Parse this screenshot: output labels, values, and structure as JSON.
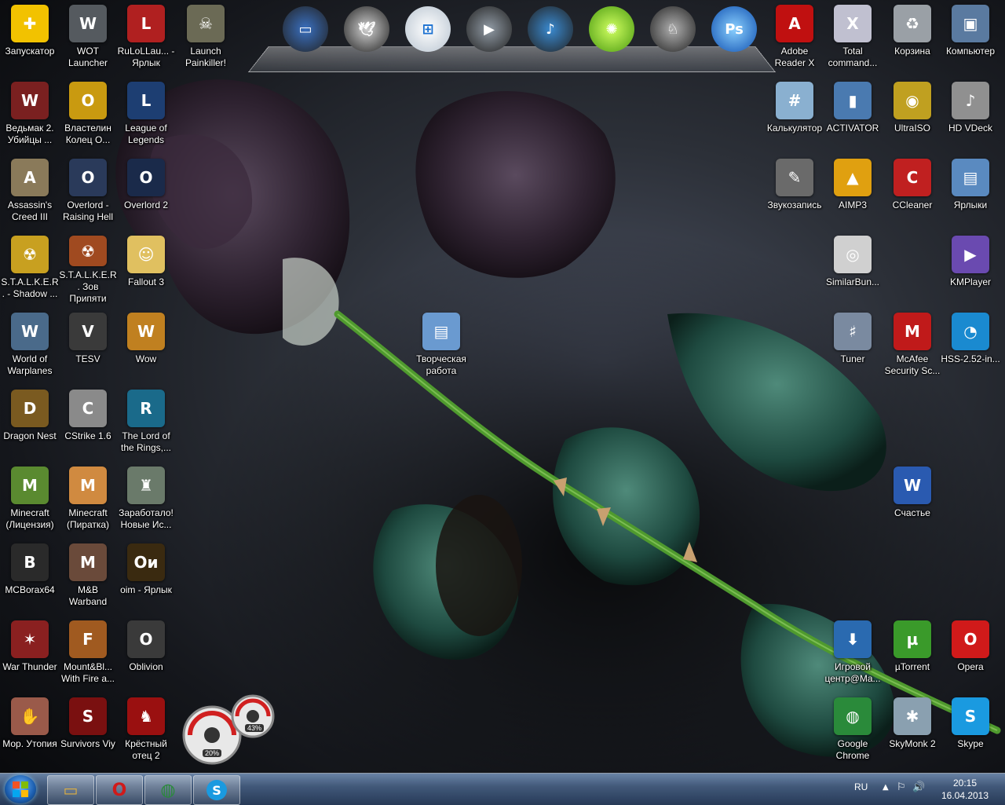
{
  "desktop": {
    "icons": [
      {
        "label": "Запускатор",
        "color": "#f2c200",
        "glyph": "✚"
      },
      {
        "label": "WOT Launcher",
        "color": "#555a5f",
        "glyph": "W"
      },
      {
        "label": "RuLoLLau... - Ярлык",
        "color": "#b02020",
        "glyph": "L"
      },
      {
        "label": "Launch Painkiller!",
        "color": "#6b6a55",
        "glyph": "☠"
      },
      {
        "label": "Ведьмак 2. Убийцы ...",
        "color": "#7a2020",
        "glyph": "W"
      },
      {
        "label": "Властелин Колец О...",
        "color": "#c99a10",
        "glyph": "O"
      },
      {
        "label": "League of Legends",
        "color": "#1d3e72",
        "glyph": "L"
      },
      {
        "label": "Assassin's Creed III",
        "color": "#8a7a5a",
        "glyph": "A"
      },
      {
        "label": "Overlord - Raising Hell",
        "color": "#2a3a5a",
        "glyph": "O"
      },
      {
        "label": "Overlord 2",
        "color": "#1a2a4a",
        "glyph": "O"
      },
      {
        "label": "S.T.A.L.K.E.R. - Shadow ...",
        "color": "#c8a020",
        "glyph": "☢"
      },
      {
        "label": "S.T.A.L.K.E.R. Зов Припяти",
        "color": "#a04a20",
        "glyph": "☢"
      },
      {
        "label": "Fallout 3",
        "color": "#e0c060",
        "glyph": "☺"
      },
      {
        "label": "World of Warplanes",
        "color": "#4a6a8a",
        "glyph": "W"
      },
      {
        "label": "TESV",
        "color": "#3a3a3a",
        "glyph": "V"
      },
      {
        "label": "Wow",
        "color": "#c08020",
        "glyph": "W"
      },
      {
        "label": "Dragon Nest",
        "color": "#7a5a20",
        "glyph": "D"
      },
      {
        "label": "CStrike 1.6",
        "color": "#8a8a8a",
        "glyph": "C"
      },
      {
        "label": "The Lord of the Rings,...",
        "color": "#1a6a8a",
        "glyph": "R"
      },
      {
        "label": "Minecraft (Лицензия)",
        "color": "#5a8a30",
        "glyph": "M"
      },
      {
        "label": "Minecraft (Пиратка)",
        "color": "#d08a40",
        "glyph": "M"
      },
      {
        "label": "Заработало! Новые Ис...",
        "color": "#6a7a6a",
        "glyph": "♜"
      },
      {
        "label": "MCBorax64",
        "color": "#2a2a2a",
        "glyph": "B"
      },
      {
        "label": "M&B Warband",
        "color": "#6a4a3a",
        "glyph": "M"
      },
      {
        "label": "oim - Ярлык",
        "color": "#3a2a10",
        "glyph": "Oи"
      },
      {
        "label": "War Thunder",
        "color": "#8a2020",
        "glyph": "✶"
      },
      {
        "label": "Mount&Bl... With Fire a...",
        "color": "#a05a20",
        "glyph": "F"
      },
      {
        "label": "Oblivion",
        "color": "#3a3a3a",
        "glyph": "O"
      },
      {
        "label": "Мор. Утопия",
        "color": "#9a5a4a",
        "glyph": "✋"
      },
      {
        "label": "Survivors Viy",
        "color": "#7a1010",
        "glyph": "S"
      },
      {
        "label": "Крёстный отец 2",
        "color": "#9a1010",
        "glyph": "♞"
      },
      {
        "label": "Творческая работа",
        "color": "#6a9ad0",
        "glyph": "▤"
      },
      {
        "label": "Adobe Reader X",
        "color": "#c01010",
        "glyph": "A"
      },
      {
        "label": "Total command...",
        "color": "#c0c0d0",
        "glyph": "X"
      },
      {
        "label": "Корзина",
        "color": "#9aa0a6",
        "glyph": "♻"
      },
      {
        "label": "Компьютер",
        "color": "#5a7aa0",
        "glyph": "▣"
      },
      {
        "label": "Калькулятор",
        "color": "#8ab0d0",
        "glyph": "#"
      },
      {
        "label": "ACTIVATOR",
        "color": "#4a7ab0",
        "glyph": "▮"
      },
      {
        "label": "UltraISO",
        "color": "#c0a020",
        "glyph": "◉"
      },
      {
        "label": "HD VDeck",
        "color": "#909090",
        "glyph": "♪"
      },
      {
        "label": "Звукозапись",
        "color": "#6a6a6a",
        "glyph": "✎"
      },
      {
        "label": "AIMP3",
        "color": "#e0a010",
        "glyph": "▲"
      },
      {
        "label": "CCleaner",
        "color": "#c02020",
        "glyph": "C"
      },
      {
        "label": "Ярлыки",
        "color": "#5a8ac0",
        "glyph": "▤"
      },
      {
        "label": "SimilarBun...",
        "color": "#d0d0d0",
        "glyph": "◎"
      },
      {
        "label": "KMPlayer",
        "color": "#6a4ab0",
        "glyph": "▶"
      },
      {
        "label": "Tuner",
        "color": "#7a8aa0",
        "glyph": "♯"
      },
      {
        "label": "McAfee Security Sc...",
        "color": "#c01a1a",
        "glyph": "M"
      },
      {
        "label": "HSS-2.52-in...",
        "color": "#1a8ad0",
        "glyph": "◔"
      },
      {
        "label": "Счастье",
        "color": "#2a5ab0",
        "glyph": "W"
      },
      {
        "label": "Игровой центр@Ma...",
        "color": "#2a6ab0",
        "glyph": "⬇"
      },
      {
        "label": "µTorrent",
        "color": "#3a9a2a",
        "glyph": "µ"
      },
      {
        "label": "Opera",
        "color": "#d01a1a",
        "glyph": "O"
      },
      {
        "label": "Google Chrome",
        "color": "#2a8a3a",
        "glyph": "◍"
      },
      {
        "label": "SkyMonk 2",
        "color": "#8aa0b0",
        "glyph": "✱"
      },
      {
        "label": "Skype",
        "color": "#1a9ae0",
        "glyph": "S"
      }
    ]
  },
  "dock": {
    "items": [
      {
        "name": "laptop-icon",
        "color": "#3a70c0",
        "glyph": "▭"
      },
      {
        "name": "cockatoo-icon",
        "color": "#d0d0d0",
        "glyph": "🕊"
      },
      {
        "name": "windows-logo-icon",
        "color": "#e0e0e0",
        "glyph": "⊞"
      },
      {
        "name": "camcorder-icon",
        "color": "#909aa4",
        "glyph": "▶"
      },
      {
        "name": "media-center-icon",
        "color": "#3a8ad0",
        "glyph": "♪"
      },
      {
        "name": "lime-icon",
        "color": "#7ac020",
        "glyph": "✺"
      },
      {
        "name": "robot-dog-icon",
        "color": "#b0b0b0",
        "glyph": "♘"
      },
      {
        "name": "photoshop-icon",
        "color": "#1a70d0",
        "glyph": "Ps"
      }
    ]
  },
  "gadget": {
    "cpu_percent": "20%",
    "ram_percent": "43%"
  },
  "taskbar": {
    "pinned": [
      {
        "name": "explorer-icon",
        "color": "#e0b040",
        "glyph": "▭"
      },
      {
        "name": "opera-icon",
        "color": "#d01a1a",
        "glyph": "O"
      },
      {
        "name": "chrome-icon",
        "color": "#2a8a3a",
        "glyph": "◍"
      },
      {
        "name": "skype-icon",
        "color": "#1a9ae0",
        "glyph": "S"
      }
    ],
    "language": "RU",
    "time": "20:15",
    "date": "16.04.2013"
  }
}
